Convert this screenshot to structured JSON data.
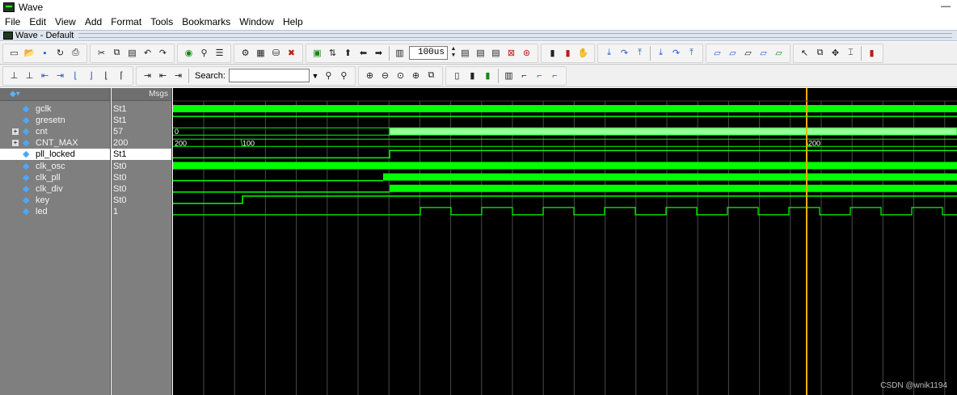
{
  "window": {
    "title": "Wave",
    "minimize": "—"
  },
  "menu": [
    "File",
    "Edit",
    "View",
    "Add",
    "Format",
    "Tools",
    "Bookmarks",
    "Window",
    "Help"
  ],
  "subwindow": {
    "title": "Wave - Default"
  },
  "toolbar": {
    "time_value": "100us",
    "search_label": "Search:",
    "search_value": ""
  },
  "panes": {
    "msgs_header": "Msgs"
  },
  "signals": [
    {
      "name": "gclk",
      "value": "St1",
      "expandable": false,
      "selected": false
    },
    {
      "name": "gresetn",
      "value": "St1",
      "expandable": false,
      "selected": false
    },
    {
      "name": "cnt",
      "value": "57",
      "expandable": true,
      "selected": false
    },
    {
      "name": "CNT_MAX",
      "value": "200",
      "expandable": true,
      "selected": false
    },
    {
      "name": "pll_locked",
      "value": "St1",
      "expandable": false,
      "selected": true
    },
    {
      "name": "clk_osc",
      "value": "St0",
      "expandable": false,
      "selected": false
    },
    {
      "name": "clk_pll",
      "value": "St0",
      "expandable": false,
      "selected": false
    },
    {
      "name": "clk_div",
      "value": "St0",
      "expandable": false,
      "selected": false
    },
    {
      "name": "key",
      "value": "St0",
      "expandable": false,
      "selected": false
    },
    {
      "name": "led",
      "value": "1",
      "expandable": false,
      "selected": false
    }
  ],
  "bus_labels": {
    "cnt": [
      "0"
    ],
    "CNT_MAX": [
      "200",
      "100",
      "200"
    ]
  },
  "colors": {
    "wave_green": "#00ff00",
    "cursor": "#ffb000",
    "background": "#000000",
    "panel": "#7f7f7f"
  },
  "watermark": "CSDN @wnik1194"
}
